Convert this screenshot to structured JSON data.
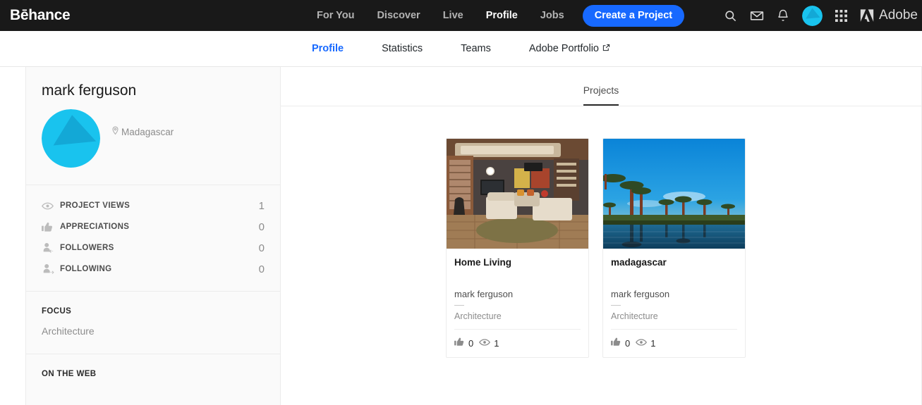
{
  "topbar": {
    "brand": "Bēhance",
    "nav": [
      {
        "label": "For You",
        "active": false
      },
      {
        "label": "Discover",
        "active": false
      },
      {
        "label": "Live",
        "active": false
      },
      {
        "label": "Profile",
        "active": true
      },
      {
        "label": "Jobs",
        "active": false
      }
    ],
    "cta_label": "Create a Project",
    "icons": [
      "search-icon",
      "mail-icon",
      "bell-icon",
      "user-avatar",
      "app-grid-icon"
    ],
    "adobe_label": "Adobe",
    "accent_color": "#1769ff",
    "background_color": "#191919"
  },
  "subnav": {
    "items": [
      {
        "label": "Profile",
        "active": true,
        "external": false
      },
      {
        "label": "Statistics",
        "active": false,
        "external": false
      },
      {
        "label": "Teams",
        "active": false,
        "external": false
      },
      {
        "label": "Adobe Portfolio",
        "active": false,
        "external": true
      }
    ],
    "active_color": "#1769ff"
  },
  "sidebar": {
    "profile": {
      "name": "mark ferguson",
      "location": "Madagascar",
      "avatar_colors": {
        "base": "#19c3ee",
        "shape": "#13a8d6"
      }
    },
    "stats": [
      {
        "icon": "eye-icon",
        "label": "PROJECT VIEWS",
        "value": "1"
      },
      {
        "icon": "thumbs-up-icon",
        "label": "APPRECIATIONS",
        "value": "0"
      },
      {
        "icon": "follower-icon",
        "label": "FOLLOWERS",
        "value": "0"
      },
      {
        "icon": "following-icon",
        "label": "FOLLOWING",
        "value": "0"
      }
    ],
    "focus": {
      "title": "FOCUS",
      "value": "Architecture"
    },
    "on_the_web": {
      "title": "ON THE WEB"
    }
  },
  "main": {
    "tabs": [
      {
        "label": "Projects",
        "active": true
      }
    ],
    "projects": [
      {
        "title": "Home Living",
        "owner": "mark ferguson",
        "field": "Architecture",
        "appreciations": "0",
        "views": "1",
        "thumbnail": "interior-living-room"
      },
      {
        "title": "madagascar",
        "owner": "mark ferguson",
        "field": "Architecture",
        "appreciations": "0",
        "views": "1",
        "thumbnail": "baobab-trees-landscape"
      }
    ]
  }
}
